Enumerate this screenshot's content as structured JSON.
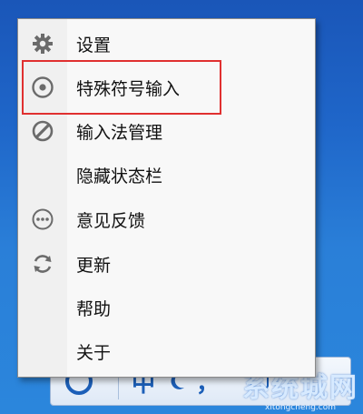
{
  "menu": {
    "items": [
      {
        "label": "设置",
        "icon": "gear-icon"
      },
      {
        "label": "特殊符号输入",
        "icon": "target-icon"
      },
      {
        "label": "输入法管理",
        "icon": "slash-circle-icon"
      },
      {
        "label": "隐藏状态栏",
        "icon": ""
      },
      {
        "label": "意见反馈",
        "icon": "ellipsis-circle-icon"
      },
      {
        "label": "更新",
        "icon": "refresh-icon"
      },
      {
        "label": "帮助",
        "icon": ""
      },
      {
        "label": "关于",
        "icon": ""
      }
    ]
  },
  "ime_bar": {
    "mode_label": "中",
    "punct_label": "，"
  },
  "watermark": {
    "text": "系统城网",
    "url": "xitongcheng.com"
  },
  "colors": {
    "highlight_border": "#e03030",
    "ime_blue": "#1c5fb8"
  }
}
